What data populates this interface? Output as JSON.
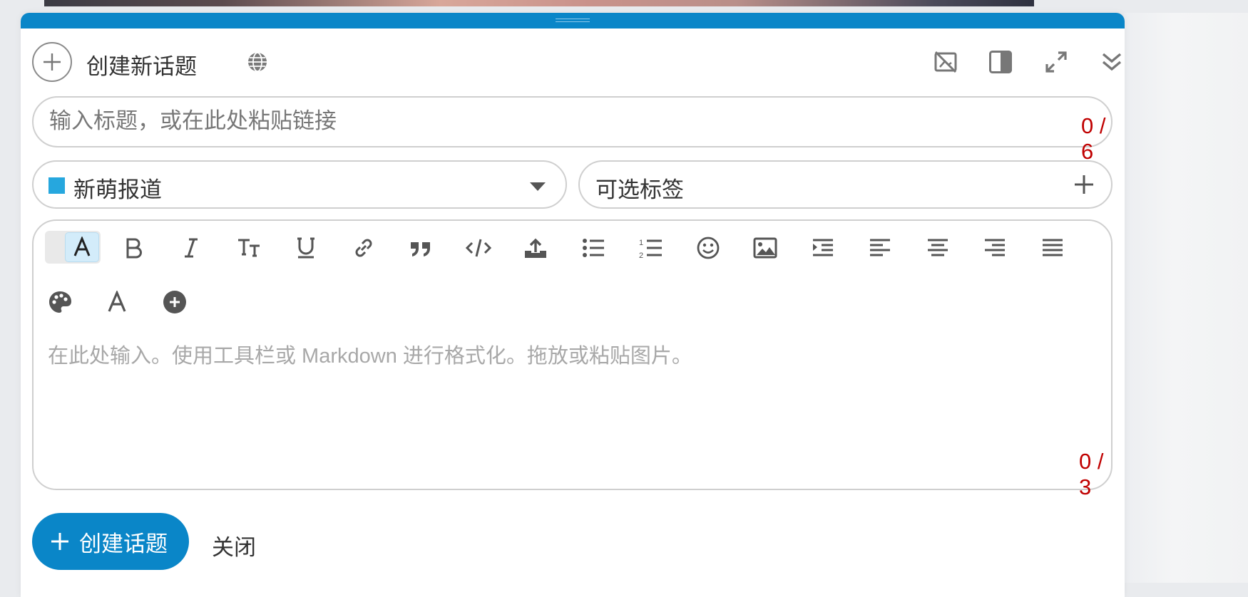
{
  "composer": {
    "header": {
      "title": "创建新话题",
      "icons": [
        "plus-icon",
        "globe-icon",
        "hide-preview-icon",
        "toggle-sidebar-icon",
        "fullscreen-icon",
        "collapse-icon"
      ]
    },
    "title_field": {
      "placeholder": "输入标题，或在此处粘贴链接",
      "value": "",
      "counter": "0 / 6"
    },
    "category": {
      "label": "新萌报道",
      "color": "#26a7de"
    },
    "tags": {
      "placeholder": "可选标签"
    },
    "editor": {
      "placeholder": "在此处输入。使用工具栏或 Markdown 进行格式化。拖放或粘贴图片。",
      "value": "",
      "counter": "0 / 3",
      "toolbar": [
        "rich-text-toggle",
        "bold",
        "italic",
        "text-size",
        "underline",
        "link",
        "quote",
        "code",
        "upload",
        "bullet-list",
        "numbered-list",
        "emoji",
        "image",
        "indent",
        "align-left",
        "align-center",
        "align-right",
        "justify",
        "color-palette",
        "font",
        "more"
      ]
    },
    "actions": {
      "create_label": "创建话题",
      "close_label": "关闭"
    },
    "colors": {
      "accent": "#0a86c8",
      "counter": "#c00000"
    }
  }
}
